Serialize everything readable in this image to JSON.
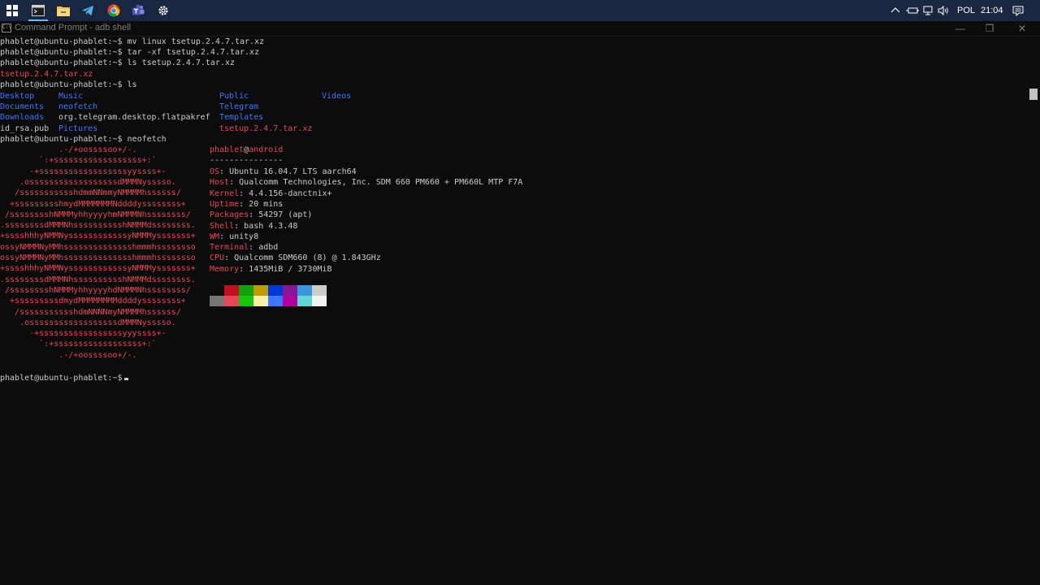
{
  "taskbar": {
    "tray_lang": "POL",
    "tray_time": "21:04",
    "icons": [
      "windows-start-icon",
      "terminal-app-icon",
      "file-explorer-icon",
      "telegram-icon",
      "chrome-icon",
      "teams-icon",
      "settings-gear-icon"
    ]
  },
  "window": {
    "title": "Command Prompt - adb  shell",
    "minimize": "—",
    "maximize": "❐",
    "close": "✕"
  },
  "terminal": {
    "prompt": "phablet@ubuntu-phablet:~$",
    "commands": {
      "mv": " mv linux tsetup.2.4.7.tar.xz",
      "tar": " tar -xf tsetup.2.4.7.tar.xz",
      "ls_file": " ls tsetup.2.4.7.tar.xz",
      "ls": " ls",
      "neofetch": " neofetch"
    },
    "ls_file_output": "tsetup.2.4.7.tar.xz",
    "ls_output": [
      [
        {
          "t": "Desktop",
          "c": "blue"
        },
        {
          "t": "Music",
          "c": "blue"
        },
        {
          "t": "Public",
          "c": "blue"
        },
        {
          "t": "Videos",
          "c": "blue"
        }
      ],
      [
        {
          "t": "Documents",
          "c": "blue"
        },
        {
          "t": "neofetch",
          "c": "blue"
        },
        {
          "t": "Telegram",
          "c": "blue"
        }
      ],
      [
        {
          "t": "Downloads",
          "c": "blue"
        },
        {
          "t": "org.telegram.desktop.flatpakref",
          "c": "plain"
        },
        {
          "t": "Templates",
          "c": "blue"
        }
      ],
      [
        {
          "t": "id_rsa.pub",
          "c": "plain"
        },
        {
          "t": "Pictures",
          "c": "blue"
        },
        {
          "t": "tsetup.2.4.7.tar.xz",
          "c": "red"
        }
      ]
    ],
    "ascii_art": [
      "            .-/+oossssoo+/-.",
      "        `:+ssssssssssssssssss+:`",
      "      -+ssssssssssssssssssyyssss+-",
      "    .ossssssssssssssssssdMMMNysssso.",
      "   /ssssssssssshdmmNNmmyNMMMMhssssss/",
      "  +ssssssssshmydMMMMMMMNddddyssssssss+",
      " /sssssssshNMMMyhhyyyyhmNMMMNhssssssss/",
      ".ssssssssdMMMNhsssssssssshNMMMdssssssss.",
      "+sssshhhyNMMNyssssssssssssyNMMMysssssss+",
      "ossyNMMMNyMMhsssssssssssssshmmmhssssssso",
      "ossyNMMMNyMMhsssssssssssssshmmmhssssssso",
      "+sssshhhyNMMNyssssssssssssyNMMMysssssss+",
      ".ssssssssdMMMNhsssssssssshNMMMdssssssss.",
      " /sssssssshNMMMyhhyyyyhdNMMMNhssssssss/",
      "  +sssssssssdmydMMMMMMMMddddyssssssss+",
      "   /ssssssssssshdmNNNNmyNMMMMhssssss/",
      "    .ossssssssssssssssssdMMMNysssso.",
      "      -+sssssssssssssssssyyyssss+-",
      "        `:+ssssssssssssssssss+:`",
      "            .-/+oossssoo+/-."
    ],
    "neofetch": {
      "user": "phablet",
      "at": "@",
      "host": "android",
      "separator": "---------------",
      "fields": [
        {
          "key": "OS",
          "value": "Ubuntu 16.04.7 LTS aarch64"
        },
        {
          "key": "Host",
          "value": "Qualcomm Technologies, Inc. SDM 660 PM660 + PM660L MTP F7A"
        },
        {
          "key": "Kernel",
          "value": "4.4.156-danctnix+"
        },
        {
          "key": "Uptime",
          "value": "20 mins"
        },
        {
          "key": "Packages",
          "value": "54297 (apt)"
        },
        {
          "key": "Shell",
          "value": "bash 4.3.48"
        },
        {
          "key": "WM",
          "value": "unity8"
        },
        {
          "key": "Terminal",
          "value": "adbd"
        },
        {
          "key": "CPU",
          "value": "Qualcomm SDM660 (8) @ 1.843GHz"
        },
        {
          "key": "Memory",
          "value": "1435MiB / 3730MiB"
        }
      ],
      "palette_top": [
        "#0c0c0c",
        "#c50f1f",
        "#13a10e",
        "#c19c00",
        "#0037da",
        "#881798",
        "#3a96dd",
        "#cccccc"
      ],
      "palette_bottom": [
        "#767676",
        "#e74856",
        "#16c60c",
        "#f9f1a5",
        "#3b78ff",
        "#b4009e",
        "#61d6d6",
        "#f2f2f2"
      ]
    }
  },
  "colors": {
    "background": "#0c0c0c",
    "foreground": "#cccccc",
    "red": "#e74856",
    "blue": "#3b78ff",
    "taskbar": "#1a2740"
  }
}
